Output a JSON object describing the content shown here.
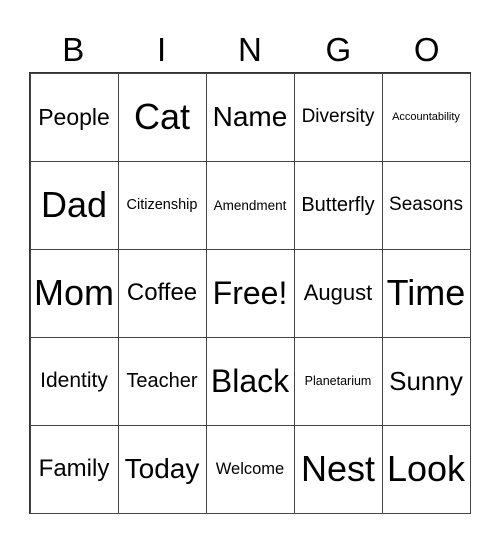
{
  "header": [
    "B",
    "I",
    "N",
    "G",
    "O"
  ],
  "cells": [
    "People",
    "Cat",
    "Name",
    "Diversity",
    "Accountability",
    "Dad",
    "Citizenship",
    "Amendment",
    "Butterfly",
    "Seasons",
    "Mom",
    "Coffee",
    "Free!",
    "August",
    "Time",
    "Identity",
    "Teacher",
    "Black",
    "Planetarium",
    "Sunny",
    "Family",
    "Today",
    "Welcome",
    "Nest",
    "Look"
  ]
}
